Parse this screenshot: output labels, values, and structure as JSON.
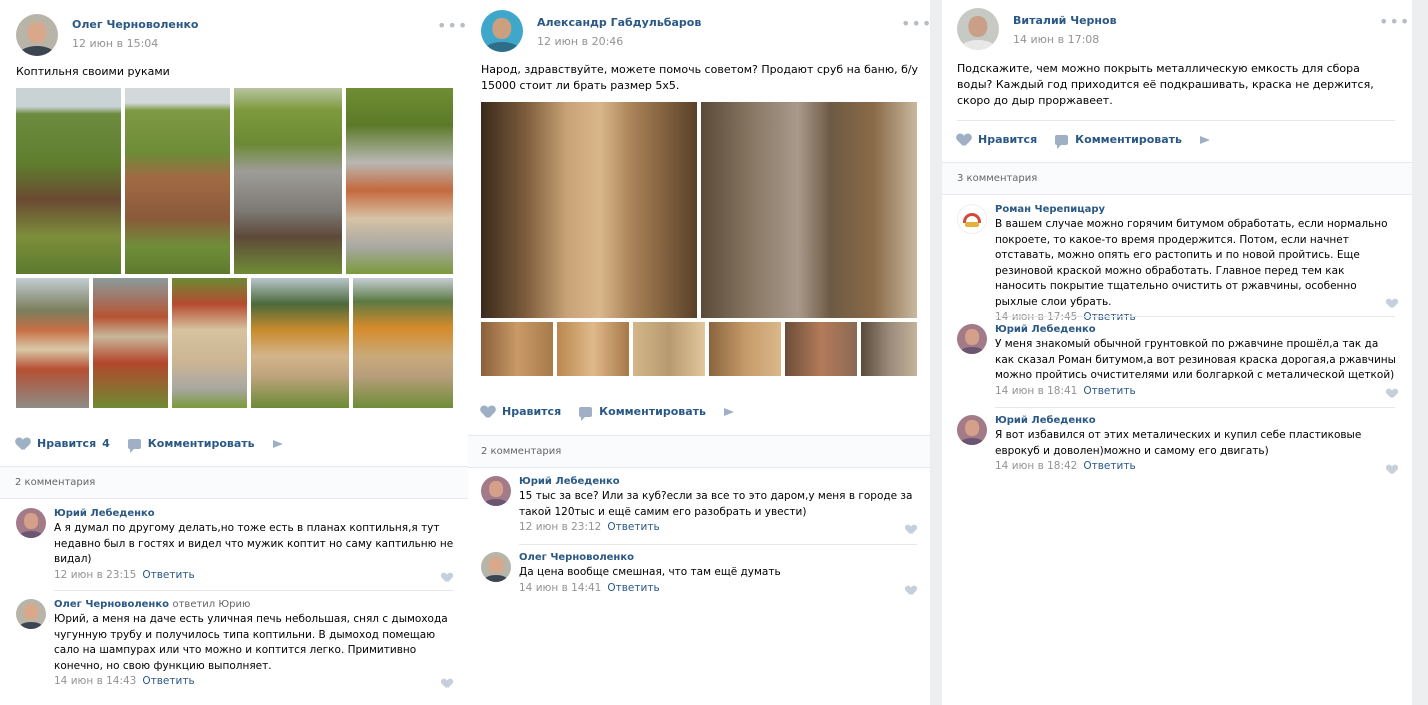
{
  "posts": [
    {
      "author": "Олег Черноволенко",
      "date": "12 июн в 15:04",
      "text": "Коптильня своими руками",
      "actions": {
        "like_label": "Нравится",
        "like_count": "4",
        "comment_label": "Комментировать"
      },
      "comments_count": "2 комментария",
      "comments": [
        {
          "author": "Юрий Лебеденко",
          "reply_to": "",
          "text": "А я думал по другому делать,но тоже есть в планах коптильня,я тут недавно был в гостях и видел что мужик коптит но саму каптильню не видал)",
          "date": "12 июн в 23:15",
          "reply": "Ответить"
        },
        {
          "author": "Олег Черноволенко",
          "reply_to": "ответил Юрию",
          "text": "Юрий, а меня на даче есть уличная печь небольшая, снял с дымохода чугунную трубу и получилось типа коптильни. В дымоход помещаю сало на шампурах или что можно и коптится легко. Примитивно конечно, но свою функцию выполняет.",
          "date": "14 июн в 14:43",
          "reply": "Ответить"
        }
      ]
    },
    {
      "author": "Александр Габдульбаров",
      "date": "12 июн в 20:46",
      "text": "Народ, здравствуйте, можете помочь советом? Продают сруб на баню, б/у 15000 стоит ли брать размер 5х5.",
      "actions": {
        "like_label": "Нравится",
        "like_count": "",
        "comment_label": "Комментировать"
      },
      "comments_count": "2 комментария",
      "comments": [
        {
          "author": "Юрий Лебеденко",
          "reply_to": "",
          "text": "15 тыс за все? Или за куб?если за все то это даром,у меня в городе за такой 120тыс и ещё самим его разобрать и увести)",
          "date": "12 июн в 23:12",
          "reply": "Ответить"
        },
        {
          "author": "Олег Черноволенко",
          "reply_to": "",
          "text": "Да цена вообще смешная, что там ещё думать",
          "date": "14 июн в 14:41",
          "reply": "Ответить"
        }
      ]
    },
    {
      "author": "Виталий Чернов",
      "date": "14 июн в 17:08",
      "text": "Подскажите, чем можно покрыть металлическую емкость для сбора воды? Каждый год приходится её подкрашивать, краска не держится, скоро до дыр проржавеет.",
      "actions": {
        "like_label": "Нравится",
        "like_count": "",
        "comment_label": "Комментировать"
      },
      "comments_count": "3 комментария",
      "comments": [
        {
          "author": "Роман Черепицару",
          "reply_to": "",
          "text": "В вашем случае можно горячим битумом обработать, если нормально покроете, то какое-то время продержится. Потом, если начнет отставать, можно опять его растопить и по новой пройтись. Еще резиновой краской можно обработать. Главное перед тем как наносить покрытие тщательно очистить от ржавчины, особенно рыхлые слои убрать.",
          "date": "14 июн в 17:45",
          "reply": "Ответить"
        },
        {
          "author": "Юрий Лебеденко",
          "reply_to": "",
          "text": "У меня знакомый обычной грунтовкой по ржавчине прошёл,а так да как сказал Роман битумом,а вот резиновая краска дорогая,а ржавчины можно пройтись очистителями или болгаркой с металической щеткой)",
          "date": "14 июн в 18:41",
          "reply": "Ответить"
        },
        {
          "author": "Юрий Лебеденко",
          "reply_to": "",
          "text": "Я вот избавился от этих металических и купил себе пластиковые еврокуб и доволен)можно и самому его двигать)",
          "date": "14 июн в 18:42",
          "reply": "Ответить"
        }
      ]
    }
  ],
  "colors": {
    "link": "#2a5885",
    "muted": "#939393",
    "icon": "#9fb0c4",
    "bar": "#fafbfc"
  },
  "icons": [
    "heart-icon",
    "comment-icon",
    "share-icon",
    "more-icon",
    "avatar"
  ]
}
